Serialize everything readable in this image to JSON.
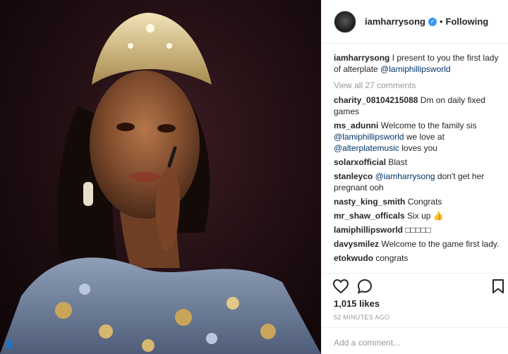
{
  "post": {
    "username": "iamharrysong",
    "verified_icon": "verified-badge-icon",
    "separator": "•",
    "follow_status": "Following"
  },
  "caption": {
    "username": "iamharrysong",
    "text": "I present to you the first lady of alterplate ",
    "mention": "@lamiphillipsworld"
  },
  "view_all": "View all 27 comments",
  "comments": [
    {
      "user": "charity_08104215088",
      "text": "Dm on daily fixed games",
      "mention": "",
      "text2": ""
    },
    {
      "user": "ms_adunni",
      "text": "Welcome to the family sis ",
      "mention": "@lamiphillipsworld",
      "text2": " we love at ",
      "mention2": "@alterplatemusic",
      "text3": " loves you"
    },
    {
      "user": "solarxofficial",
      "text": "Blast",
      "mention": "",
      "text2": ""
    },
    {
      "user": "stanleyco",
      "text": "",
      "mention": "@iamharrysong",
      "text2": " don't get her pregnant ooh"
    },
    {
      "user": "nasty_king_smith",
      "text": "Congrats",
      "mention": "",
      "text2": ""
    },
    {
      "user": "mr_shaw_officals",
      "text": "Six up 👍",
      "mention": "",
      "text2": ""
    },
    {
      "user": "lamiphillipsworld",
      "text": "□□□□□",
      "mention": "",
      "text2": ""
    },
    {
      "user": "davysmilez",
      "text": "Welcome to the game first lady.",
      "mention": "",
      "text2": ""
    },
    {
      "user": "etokwudo",
      "text": "congrats",
      "mention": "",
      "text2": ""
    }
  ],
  "likes": "1,015 likes",
  "time": "52 MINUTES AGO",
  "add_comment_placeholder": "Add a comment...",
  "icons": {
    "like": "heart-icon",
    "comment": "comment-icon",
    "save": "bookmark-icon",
    "user_tag": "user-tag-icon"
  }
}
